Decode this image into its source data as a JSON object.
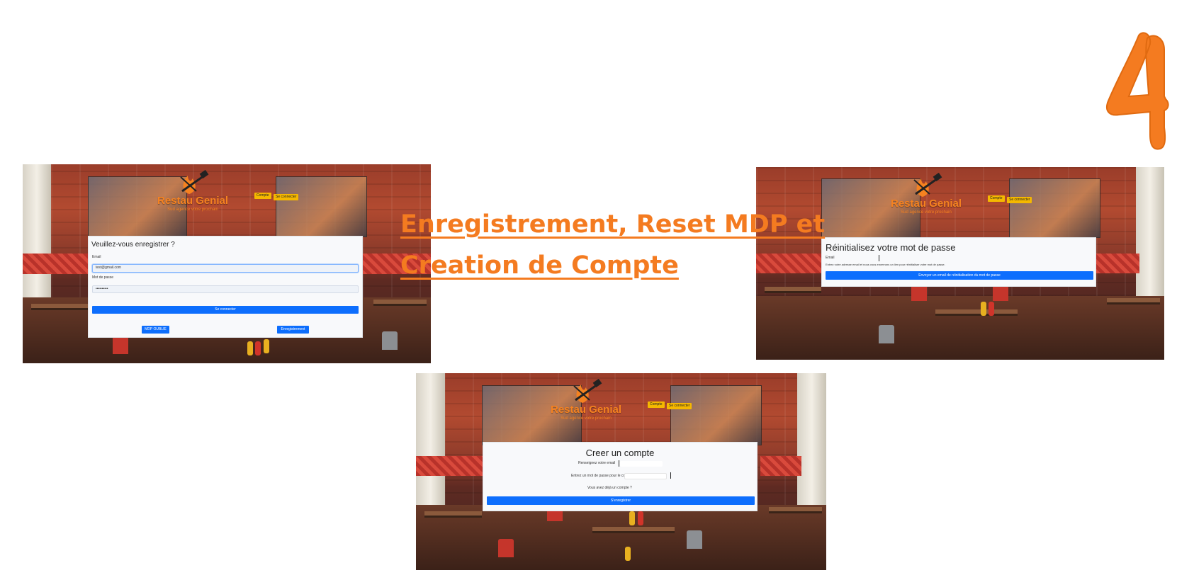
{
  "slide": {
    "title": "Enregistrement, Reset MDP et Creation de Compte",
    "number": "4"
  },
  "site": {
    "brand": "Restau Genial",
    "tagline": "Sud agence votre prochain",
    "nav": {
      "login_label": "Se connecter",
      "account_label": "Compte"
    }
  },
  "login": {
    "heading": "Veuillez-vous enregistrer ?",
    "email_label": "Email",
    "email_value": "test@gmail.com",
    "password_label": "Mot de passe",
    "password_value": "••••••••••",
    "submit_label": "Se connecter",
    "forgot_label": "MDP OUBLIE",
    "register_label": "Enregistrement"
  },
  "reset": {
    "heading": "Réinitialisez votre mot de passe",
    "email_label": "Email",
    "hint": "Entrez votre adresse email et nous vous enverrons un lien pour réinitialiser votre mot de passe.",
    "submit_label": "Envoyer un email de réinitialisation du mot de passe"
  },
  "create": {
    "heading": "Creer un compte",
    "email_label": "Renseignez votre email",
    "password_label": "Entrez un mot de passe pour le compte",
    "login_link": "Vous avez déjà un compte ?",
    "submit_label": "S'enregistrer"
  },
  "colors": {
    "accent": "#f47b20",
    "primary_button": "#0d6efd",
    "nav_button": "#f5b800"
  }
}
